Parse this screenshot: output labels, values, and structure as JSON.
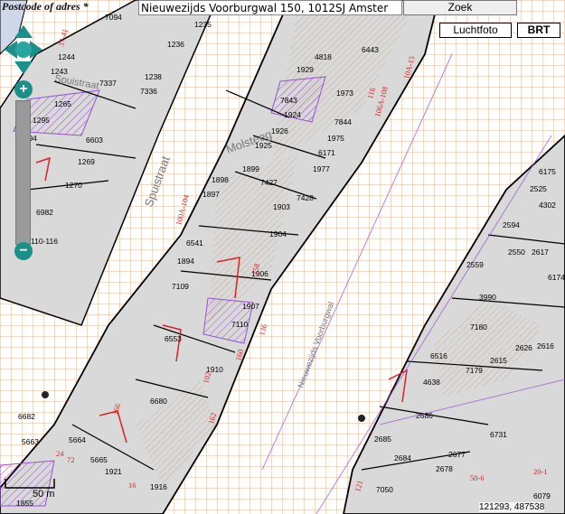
{
  "header": {
    "address_label": "Postcode of adres *",
    "address_value": "Nieuwezijds Voorburgwal 150, 1012SJ Amster",
    "search_button": "Zoek"
  },
  "layers": {
    "aerial_label": "Luchtfoto",
    "brt_label": "BRT"
  },
  "zoom": {
    "in_label": "+",
    "out_label": "−"
  },
  "scale": {
    "label": "50 m"
  },
  "coords": {
    "text": "121293, 487538"
  },
  "map": {
    "street_labels": [
      "Spuistraat",
      "Nieuwezijds Voorburgwal",
      "Molsteeg",
      "Spuistraat"
    ],
    "parcel_numbers": [
      "1235",
      "1236",
      "1244",
      "1243",
      "7337",
      "1238",
      "7336",
      "1265",
      "1295",
      "1294",
      "6603",
      "1269",
      "1270",
      "6982",
      "110-116",
      "7094",
      "4818",
      "6443",
      "1929",
      "1973",
      "7843",
      "1924",
      "7844",
      "1926",
      "1975",
      "1925",
      "6171",
      "1977",
      "1899",
      "7427",
      "7428",
      "1898",
      "1897",
      "1903",
      "1904",
      "6541",
      "1894",
      "1906",
      "7109",
      "1907",
      "7110",
      "6553",
      "1910",
      "6680",
      "6682",
      "5663",
      "5664",
      "5665",
      "1921",
      "1916",
      "2686",
      "6731",
      "2685",
      "2684",
      "2677",
      "2678",
      "7050",
      "6079",
      "6175",
      "2525",
      "2594",
      "4302",
      "6174",
      "3990",
      "2559",
      "2550",
      "2617",
      "7180",
      "2626",
      "2616",
      "6516",
      "7179",
      "2615",
      "4638",
      "1855"
    ],
    "red_labels": [
      "37-41",
      "10A-15",
      "106A-108",
      "100A-104",
      "116",
      "136",
      "158",
      "160",
      "102",
      "166",
      "162",
      "24",
      "72",
      "16",
      "121",
      "50-6",
      "20-1"
    ]
  },
  "colors": {
    "grid": "#e0a070",
    "parcel_fill": "#d9d9d9",
    "hatch": "#e8d4c4",
    "purple": "#9b4fd4",
    "red": "#e02020",
    "teal": "#1b8f8a"
  }
}
